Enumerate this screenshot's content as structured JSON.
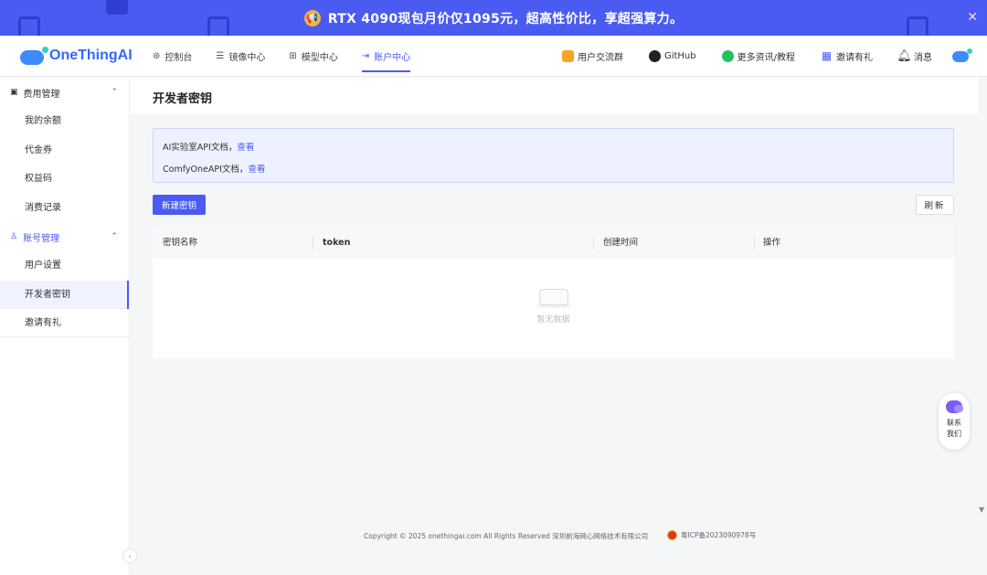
{
  "promo": {
    "text": "RTX 4090现包月价仅1095元，超高性价比，享超强算力。",
    "megaphone_icon": "megaphone-icon",
    "close_glyph": "✕"
  },
  "nav": {
    "logo_text": "OneThingAI",
    "menu": [
      {
        "label": "控制台",
        "icon": "dashboard-icon",
        "glyph": "⊛"
      },
      {
        "label": "镜像中心",
        "icon": "image-icon",
        "glyph": "☰"
      },
      {
        "label": "模型中心",
        "icon": "model-icon",
        "glyph": "⊞"
      },
      {
        "label": "账户中心",
        "icon": "account-icon",
        "glyph": "⇥",
        "active": true
      }
    ],
    "right_links": [
      {
        "label": "用户交流群",
        "icon": "group-chat-icon",
        "glyph": "◆"
      },
      {
        "label": "GitHub",
        "icon": "github-icon",
        "glyph": "●"
      },
      {
        "label": "更多资讯/教程",
        "icon": "wechat-icon",
        "glyph": "●"
      },
      {
        "label": "邀请有礼",
        "icon": "gift-icon",
        "glyph": "▦"
      },
      {
        "label": "消息",
        "icon": "bell-icon",
        "glyph": "♫"
      }
    ]
  },
  "sidebar": {
    "groups": [
      {
        "label": "费用管理",
        "icon": "wallet-icon",
        "glyph": "▣",
        "chevron": "⌃",
        "items": [
          {
            "label": "我的余额"
          },
          {
            "label": "代金券"
          },
          {
            "label": "权益码"
          },
          {
            "label": "消费记录"
          }
        ]
      },
      {
        "label": "账号管理",
        "icon": "user-icon",
        "glyph": "♙",
        "chevron": "⌃",
        "items": [
          {
            "label": "用户设置"
          },
          {
            "label": "开发者密钥",
            "active": true
          },
          {
            "label": "邀请有礼"
          }
        ]
      }
    ],
    "collapse_glyph": "‹"
  },
  "main": {
    "title": "开发者密钥",
    "notice": {
      "line1_prefix": "AI实验室API文档，",
      "line1_link": "查看",
      "line2_prefix": "ComfyOneAPI文档，",
      "line2_link": "查看"
    },
    "new_key_button": "新建密钥",
    "refresh_button": "刷新",
    "table": {
      "columns": [
        "密钥名称",
        "token",
        "创建时间",
        "操作"
      ],
      "rows": [],
      "empty_text": "暂无数据"
    }
  },
  "contact": {
    "line1": "联系",
    "line2": "我们"
  },
  "footer": {
    "copyright": "Copyright © 2025 onethingai.com All Rights Reserved 深圳前海网心网络技术有限公司",
    "icp": "粤ICP备2023090978号"
  },
  "scroll_glyph": "▼",
  "colors": {
    "accent": "#4a5bf2",
    "banner": "#4a5bf2",
    "notice_bg": "#eef1ff"
  }
}
